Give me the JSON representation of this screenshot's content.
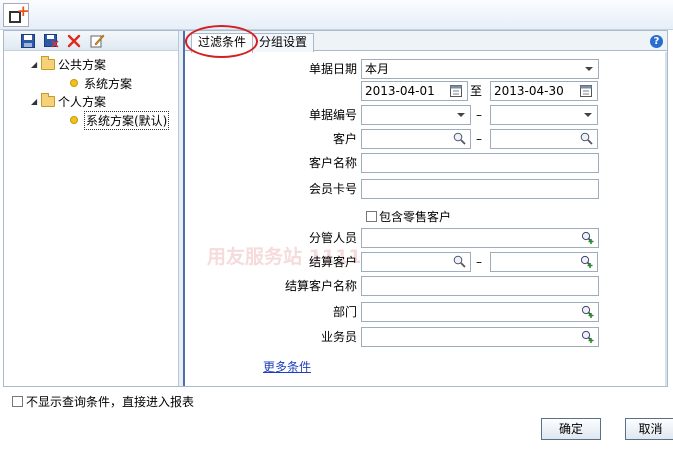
{
  "window": {
    "icon": "new-document-plus-icon"
  },
  "left_toolbar": {
    "icons": [
      "save-icon",
      "save-as-icon",
      "delete-icon",
      "edit-icon"
    ]
  },
  "tree": {
    "public": {
      "label": "公共方案",
      "children": [
        "系统方案"
      ]
    },
    "personal": {
      "label": "个人方案",
      "children": [
        "系统方案(默认)"
      ]
    }
  },
  "tabs": [
    {
      "label": "过滤条件",
      "active": true
    },
    {
      "label": "分组设置",
      "active": false
    }
  ],
  "form": {
    "date_label": "单据日期",
    "date_period": "本月",
    "date_from": "2013-04-01",
    "date_to_sep": "至",
    "date_to": "2013-04-30",
    "docno_label": "单据编号",
    "docno_from": "",
    "docno_to": "",
    "range_sep": "–",
    "customer_label": "客户",
    "customer_from": "",
    "customer_to": "",
    "customer_name_label": "客户名称",
    "customer_name": "",
    "member_card_label": "会员卡号",
    "member_card": "",
    "include_retail_label": "包含零售客户",
    "manager_label": "分管人员",
    "manager": "",
    "settle_customer_label": "结算客户",
    "settle_customer_from": "",
    "settle_customer_to": "",
    "settle_customer_name_label": "结算客户名称",
    "settle_customer_name": "",
    "dept_label": "部门",
    "dept": "",
    "salesman_label": "业务员",
    "salesman": "",
    "more_link": "更多条件",
    "watermark": "用友服务站 1111wz.com"
  },
  "footer": {
    "skip_label": "不显示查询条件，直接进入报表",
    "ok": "确定",
    "cancel": "取消"
  },
  "colors": {
    "annotation_circle": "#d52020",
    "link": "#1f3fbf",
    "splitter": "#4f6ea3"
  }
}
